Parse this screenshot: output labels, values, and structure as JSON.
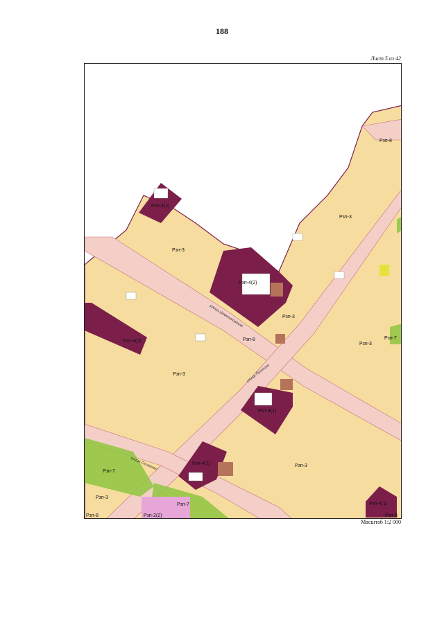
{
  "page": {
    "number": "188",
    "sheet": "Лист 5 из 42",
    "scale": "Масштаб 1:2 000"
  },
  "colors": {
    "residential": "#f7dca0",
    "zone_ripz_4": "#7b1f4a",
    "street": "#f4cfc8",
    "green": "#8ec63f",
    "pink": "#e6a6d8",
    "building": "#ffffff",
    "brown": "#b5745a",
    "yellow": "#e5e23a"
  },
  "map": {
    "zones": [
      "Рзп-8",
      "Рзп-3",
      "Рзп-4(2)",
      "Рзп-3",
      "Рзп-4(2)",
      "Рзп-3",
      "Рзп-4(2)",
      "Рзп-8",
      "Рзп-3",
      "Рзп-3",
      "Рзп-7",
      "Рзп-4(1)",
      "Рзп-7",
      "Рзп-4(1)",
      "Рзп-3",
      "Рзп-3",
      "Рзп-7",
      "Рзп-8",
      "Рзп-2(2)",
      "Рзп-4(1)",
      "Рзп-8"
    ],
    "streets": [
      "улица Шевченковская",
      "улица Пушкина",
      "улица Осипенко"
    ]
  }
}
